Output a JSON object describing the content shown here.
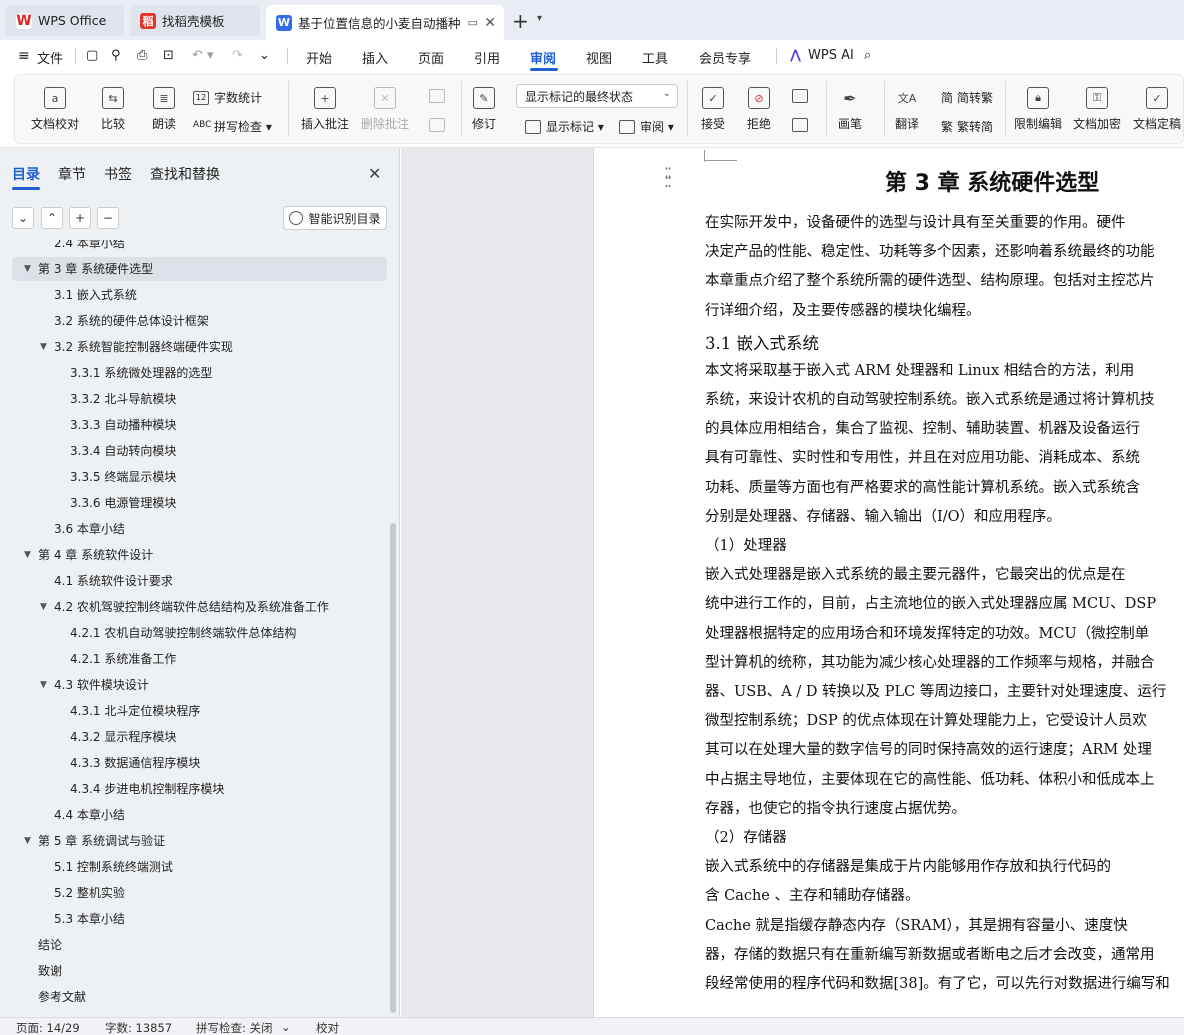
{
  "tabs": [
    {
      "icon": "wps-logo-icon",
      "label": "WPS Office"
    },
    {
      "icon": "daoke-icon",
      "label": "找稻壳模板"
    },
    {
      "icon": "word-doc-icon",
      "label": "基于位置信息的小麦自动播种"
    }
  ],
  "menu": {
    "file": "文件",
    "items": [
      "开始",
      "插入",
      "页面",
      "引用",
      "审阅",
      "视图",
      "工具",
      "会员专享"
    ],
    "active": "审阅",
    "ai": "WPS AI"
  },
  "ribbon": {
    "proofread": "文档校对",
    "compare": "比较",
    "read_aloud": "朗读",
    "word_count": "字数统计",
    "spell_check": "拼写检查",
    "insert_comment": "插入批注",
    "delete_comment": "删除批注",
    "track": "修订",
    "markup_combo": "显示标记的最终状态",
    "show_markup": "显示标记",
    "review": "审阅",
    "accept": "接受",
    "reject": "拒绝",
    "pen": "画笔",
    "translate": "翻译",
    "to_traditional": "简转繁",
    "to_simplified": "繁转简",
    "restrict_edit": "限制编辑",
    "encrypt": "文档加密",
    "finalize": "文档定稿"
  },
  "panel": {
    "tabs": [
      "目录",
      "章节",
      "书签",
      "查找和替换"
    ],
    "active_tab": "目录",
    "smart_toc": "智能识别目录",
    "toc": [
      {
        "level": 2,
        "text": "2.4  本章小结",
        "partial": true
      },
      {
        "level": 1,
        "text": "第 3 章  系统硬件选型",
        "expanded": true,
        "selected": true
      },
      {
        "level": 2,
        "text": "3.1  嵌入式系统"
      },
      {
        "level": 2,
        "text": "3.2  系统的硬件总体设计框架"
      },
      {
        "level": 2,
        "text": "3.2  系统智能控制器终端硬件实现",
        "expanded": true
      },
      {
        "level": 3,
        "text": "3.3.1  系统微处理器的选型"
      },
      {
        "level": 3,
        "text": "3.3.2  北斗导航模块"
      },
      {
        "level": 3,
        "text": "3.3.3  自动播种模块"
      },
      {
        "level": 3,
        "text": "3.3.4  自动转向模块"
      },
      {
        "level": 3,
        "text": "3.3.5  终端显示模块"
      },
      {
        "level": 3,
        "text": "3.3.6  电源管理模块"
      },
      {
        "level": 2,
        "text": "3.6  本章小结"
      },
      {
        "level": 1,
        "text": "第 4 章  系统软件设计",
        "expanded": true
      },
      {
        "level": 2,
        "text": "4.1  系统软件设计要求"
      },
      {
        "level": 2,
        "text": "4.2  农机驾驶控制终端软件总结结构及系统准备工作",
        "expanded": true
      },
      {
        "level": 3,
        "text": "4.2.1  农机自动驾驶控制终端软件总体结构"
      },
      {
        "level": 3,
        "text": "4.2.1  系统准备工作"
      },
      {
        "level": 2,
        "text": "4.3  软件模块设计",
        "expanded": true
      },
      {
        "level": 3,
        "text": "4.3.1  北斗定位模块程序"
      },
      {
        "level": 3,
        "text": "4.3.2  显示程序模块"
      },
      {
        "level": 3,
        "text": "4.3.3  数据通信程序模块"
      },
      {
        "level": 3,
        "text": "4.3.4  步进电机控制程序模块"
      },
      {
        "level": 2,
        "text": "4.4  本章小结"
      },
      {
        "level": 1,
        "text": " 第 5 章  系统调试与验证",
        "expanded": true
      },
      {
        "level": 2,
        "text": "5.1  控制系统终端测试"
      },
      {
        "level": 2,
        "text": "5.2  整机实验"
      },
      {
        "level": 2,
        "text": "5.3  本章小结"
      },
      {
        "level": 1,
        "text": "结论"
      },
      {
        "level": 1,
        "text": "致谢"
      },
      {
        "level": 1,
        "text": "参考文献"
      }
    ]
  },
  "document": {
    "lines": [
      {
        "type": "h1",
        "text": "第 3 章  系统硬件选型"
      },
      {
        "type": "p",
        "text": "      在实际开发中，设备硬件的选型与设计具有至关重要的作用。硬件"
      },
      {
        "type": "p",
        "text": "决定产品的性能、稳定性、功耗等多个因素，还影响着系统最终的功能"
      },
      {
        "type": "p",
        "text": "本章重点介绍了整个系统所需的硬件选型、结构原理。包括对主控芯片"
      },
      {
        "type": "p",
        "text": "行详细介绍，及主要传感器的模块化编程。"
      },
      {
        "type": "h2",
        "text": "3.1  嵌入式系统"
      },
      {
        "type": "p",
        "text": "    本文将采取基于嵌入式 ARM 处理器和  Linux  相结合的方法，利用"
      },
      {
        "type": "p",
        "text": "系统，来设计农机的自动驾驶控制系统。嵌入式系统是通过将计算机技"
      },
      {
        "type": "p",
        "text": "的具体应用相结合，集合了监视、控制、辅助装置、机器及设备运行"
      },
      {
        "type": "p",
        "text": "具有可靠性、实时性和专用性，并且在对应用功能、消耗成本、系统"
      },
      {
        "type": "p",
        "text": "功耗、质量等方面也有严格要求的高性能计算机系统。嵌入式系统含"
      },
      {
        "type": "p",
        "text": "分别是处理器、存储器、输入输出（I/O）和应用程序。"
      },
      {
        "type": "p",
        "text": "（1）处理器"
      },
      {
        "type": "p",
        "text": "      嵌入式处理器是嵌入式系统的最主要元器件，它最突出的优点是在"
      },
      {
        "type": "p",
        "text": "统中进行工作的，目前，占主流地位的嵌入式处理器应属  MCU、DSP"
      },
      {
        "type": "p",
        "text": "处理器根据特定的应用场合和环境发挥特定的功效。MCU（微控制单"
      },
      {
        "type": "p",
        "text": "型计算机的统称，其功能为减少核心处理器的工作频率与规格，并融合"
      },
      {
        "type": "p",
        "text": "器、USB、A / D  转换以及 PLC  等周边接口，主要针对处理速度、运行"
      },
      {
        "type": "p",
        "text": "微型控制系统；DSP  的优点体现在计算处理能力上，它受设计人员欢"
      },
      {
        "type": "p",
        "text": "其可以在处理大量的数字信号的同时保持高效的运行速度；ARM 处理"
      },
      {
        "type": "p",
        "text": "中占据主导地位，主要体现在它的高性能、低功耗、体积小和低成本上"
      },
      {
        "type": "p",
        "text": "存器，也使它的指令执行速度占据优势。"
      },
      {
        "type": "p",
        "text": "（2）存储器"
      },
      {
        "type": "p",
        "text": "      嵌入式系统中的存储器是集成于片内能够用作存放和执行代码的"
      },
      {
        "type": "p",
        "text": "含 Cache 、主存和辅助存储器。"
      },
      {
        "type": "p",
        "text": "      Cache 就是指缓存静态内存（SRAM），其是拥有容量小、速度快"
      },
      {
        "type": "p",
        "text": "器，存储的数据只有在重新编写新数据或者断电之后才会改变，通常用"
      },
      {
        "type": "p",
        "text": "段经常使用的程序代码和数据[38]。有了它，可以先行对数据进行编写和"
      }
    ]
  },
  "status": {
    "page": "页面: 14/29",
    "words": "字数: 13857",
    "spell": "拼写检查: 关闭",
    "proof": "校对"
  }
}
